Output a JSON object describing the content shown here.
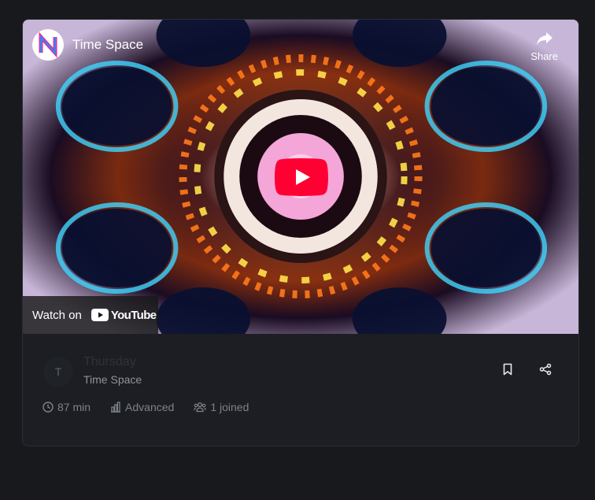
{
  "video": {
    "title": "Time Space",
    "share_label": "Share",
    "watch_on_label": "Watch on",
    "youtube_wordmark": "YouTube",
    "icons": {
      "play": "play-icon",
      "share": "share-arrow-icon",
      "youtube": "youtube-logo-icon"
    },
    "colors": {
      "play_button": "#ff0033"
    }
  },
  "event": {
    "avatar_initial": "T",
    "title": "Thursday",
    "subtitle": "Time Space",
    "actions": {
      "bookmark_icon": "bookmark-icon",
      "share_icon": "share-nodes-icon"
    },
    "stats": {
      "duration": "87 min",
      "level": "Advanced",
      "participants": "1 joined"
    }
  }
}
